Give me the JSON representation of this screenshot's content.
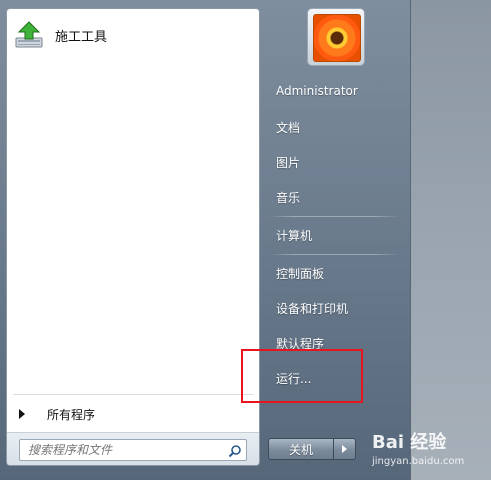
{
  "programs": {
    "pinned": [
      {
        "label": "施工工具",
        "icon": "install-tool-icon"
      }
    ],
    "all_programs_label": "所有程序"
  },
  "search": {
    "placeholder": "搜索程序和文件"
  },
  "user": {
    "picture": "flower-avatar"
  },
  "right_menu": {
    "items": [
      {
        "label": "Administrator"
      },
      {
        "label": "文档"
      },
      {
        "label": "图片"
      },
      {
        "label": "音乐"
      },
      {
        "label": "计算机"
      },
      {
        "label": "控制面板"
      },
      {
        "label": "设备和打印机"
      },
      {
        "label": "默认程序"
      },
      {
        "label": "运行..."
      }
    ]
  },
  "shutdown": {
    "label": "关机"
  },
  "watermark": {
    "logo": "Bai 经验",
    "sub": "jingyan.baidu.com"
  },
  "colors": {
    "highlight": "#e6151e",
    "menu_bg": "#68798b"
  }
}
